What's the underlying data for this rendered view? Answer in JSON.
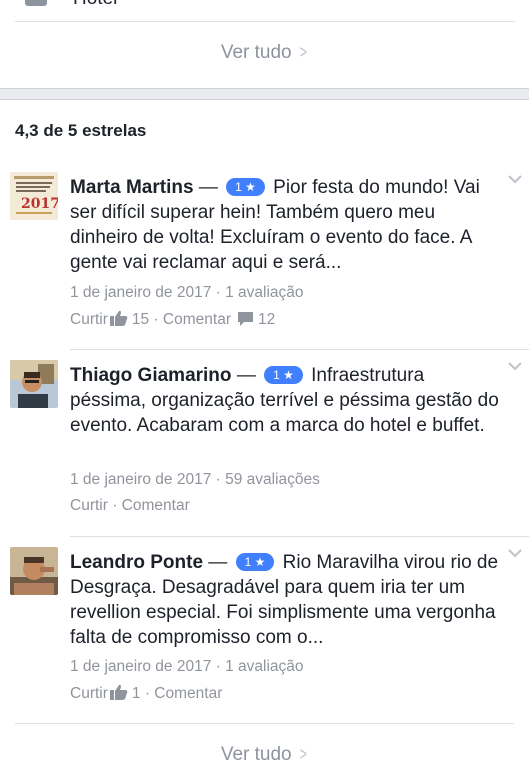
{
  "previous_section": {
    "item_label": "Hotel",
    "see_all_label": "Ver tudo"
  },
  "ratings": {
    "summary": "4,3 de 5 estrelas"
  },
  "reviews": [
    {
      "author": "Marta Martins",
      "separator": "—",
      "stars_badge": "1 ★",
      "text": "Pior festa do mundo! Vai ser difícil superar hein! Também quero meu dinheiro de volta! Excluíram o evento do face. A gente vai reclamar aqui e será...",
      "date": "1 de janeiro de 2017",
      "reviewer_count": "1 avaliação",
      "like_label": "Curtir",
      "likes": "15",
      "comment_label": "Comentar",
      "comments": "12"
    },
    {
      "author": "Thiago Giamarino",
      "separator": "—",
      "stars_badge": "1 ★",
      "text": "Infraestrutura péssima, organização terrível e péssima gestão do evento. Acabaram com a marca do hotel e buffet.",
      "date": "1 de janeiro de 2017",
      "reviewer_count": "59 avaliações",
      "like_label": "Curtir",
      "comment_label": "Comentar"
    },
    {
      "author": "Leandro Ponte",
      "separator": "—",
      "stars_badge": "1 ★",
      "text": "Rio Maravilha virou rio de Desgraça. Desagradável para quem iria ter um revellion especial. Foi simplismente uma vergonha falta de compromisso com o...",
      "date": "1 de janeiro de 2017",
      "reviewer_count": "1 avaliação",
      "like_label": "Curtir",
      "likes": "1",
      "comment_label": "Comentar"
    }
  ],
  "see_all_bottom": "Ver tudo",
  "colors": {
    "badge": "#4080ff",
    "meta_text": "#90949c",
    "separator_bg": "#e9ebee"
  }
}
